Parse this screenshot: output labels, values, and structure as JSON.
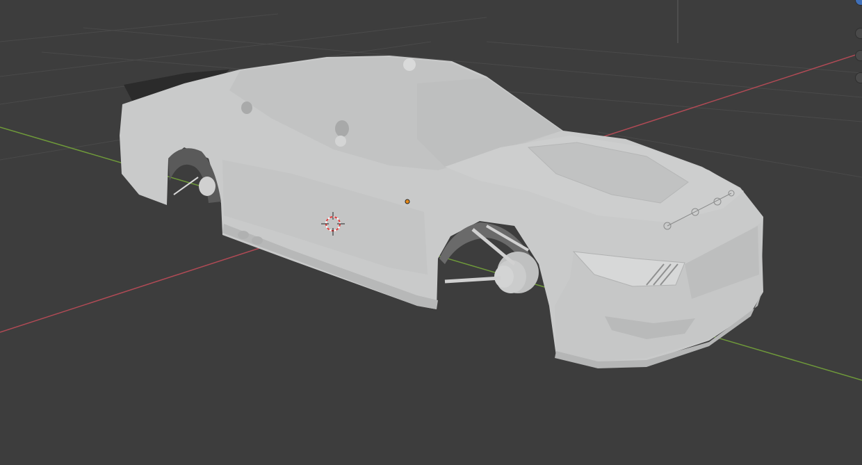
{
  "viewport": {
    "background": "#3d3d3d",
    "grid_color": "#4a4a4a",
    "axis_x_color": "#b04a55",
    "axis_y_color": "#6f9a3a",
    "axis_z_color": "#555555"
  },
  "model": {
    "name": "race-car-body",
    "color": "#c9caca",
    "shade_color": "#b3b4b4"
  },
  "overlays": {
    "origin_dot_color": "#e68a1a",
    "cursor_color_primary": "#e43f3f",
    "cursor_color_secondary": "#ffffff"
  },
  "gizmo": {
    "icons": [
      "navigation-axis-icon",
      "zoom-icon",
      "pan-icon",
      "camera-icon"
    ]
  }
}
